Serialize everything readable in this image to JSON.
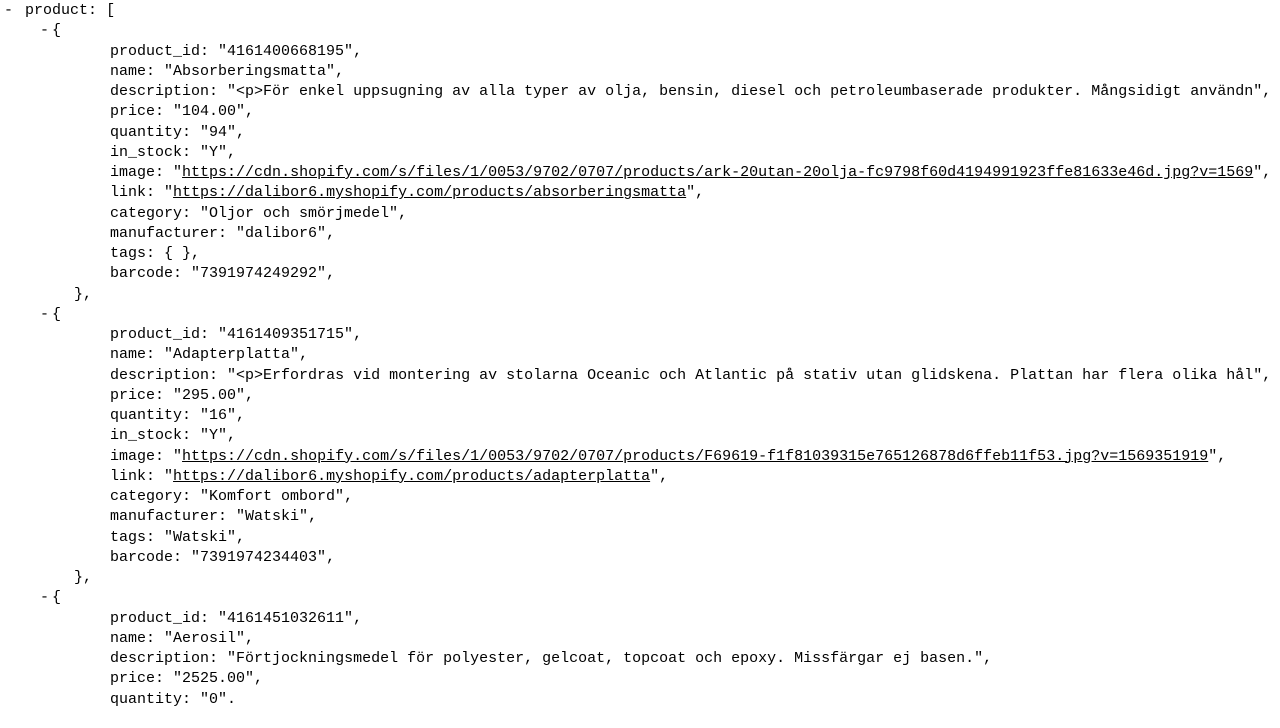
{
  "rootKey": "product",
  "collapseGlyph": "-",
  "products": [
    {
      "product_id": "4161400668195",
      "name": "Absorberingsmatta",
      "description": "<p>För enkel uppsugning av alla typer av olja, bensin, diesel och petroleumbaserade produkter. Mångsidigt användn",
      "price": "104.00",
      "quantity": "94",
      "in_stock": "Y",
      "image": "https://cdn.shopify.com/s/files/1/0053/9702/0707/products/ark-20utan-20olja-fc9798f60d4194991923ffe81633e46d.jpg?v=1569",
      "link": "https://dalibor6.myshopify.com/products/absorberingsmatta",
      "category": "Oljor och smörjmedel",
      "manufacturer": "dalibor6",
      "tags": "{ }",
      "barcode": "7391974249292"
    },
    {
      "product_id": "4161409351715",
      "name": "Adapterplatta",
      "description": "<p>Erfordras vid montering av stolarna Oceanic och Atlantic på stativ utan glidskena. Plattan har flera olika hål",
      "price": "295.00",
      "quantity": "16",
      "in_stock": "Y",
      "image": "https://cdn.shopify.com/s/files/1/0053/9702/0707/products/F69619-f1f81039315e765126878d6ffeb11f53.jpg?v=1569351919",
      "link": "https://dalibor6.myshopify.com/products/adapterplatta",
      "category": "Komfort ombord",
      "manufacturer": "Watski",
      "tags": "\"Watski\"",
      "barcode": "7391974234403"
    },
    {
      "product_id": "4161451032611",
      "name": "Aerosil",
      "description": "Förtjockningsmedel för polyester, gelcoat, topcoat och epoxy. Missfärgar ej basen.",
      "price": "2525.00",
      "quantity": "0"
    }
  ]
}
